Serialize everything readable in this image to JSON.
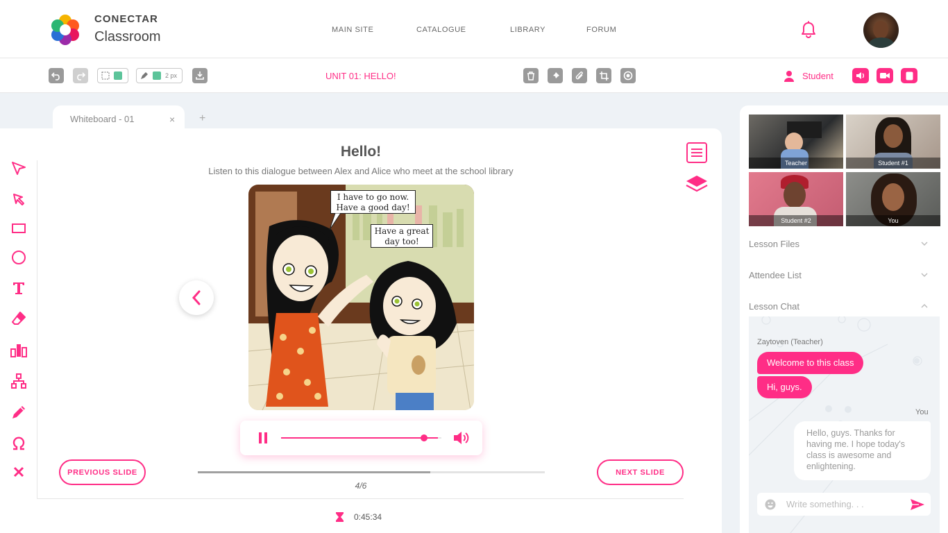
{
  "brand": {
    "name_top": "CONECTAR",
    "name_bottom": "Classroom"
  },
  "nav": [
    "MAIN SITE",
    "CATALOGUE",
    "LIBRARY",
    "FORUM"
  ],
  "toolbar": {
    "unit_title": "UNIT 01: HELLO!",
    "stroke_size": "2 px",
    "role_label": "Student"
  },
  "tabs": {
    "active": "Whiteboard - 01",
    "close": "×",
    "add": "+"
  },
  "slide": {
    "title": "Hello!",
    "subtitle": "Listen to this dialogue between Alex and Alice who meet at the school library",
    "bubble1_line1": "I have to go now.",
    "bubble1_line2": "Have a good day!",
    "bubble2_line1": "Have a great",
    "bubble2_line2": "day too!",
    "prev_label": "PREVIOUS SLIDE",
    "next_label": "NEXT SLIDE",
    "page_indicator": "4/6",
    "timer": "0:45:34",
    "audio_progress": 0.98,
    "slides_progress": 0.67
  },
  "videos": [
    {
      "label": "Teacher"
    },
    {
      "label": "Student #1"
    },
    {
      "label": "Student #2"
    },
    {
      "label": "You"
    }
  ],
  "accordion": {
    "files": "Lesson Files",
    "attendees": "Attendee List",
    "chat": "Lesson Chat"
  },
  "chat": {
    "teacher_name": "Zaytoven (Teacher)",
    "teacher_msg1": "Welcome to this class",
    "teacher_msg2": "Hi, guys.",
    "you_label": "You",
    "you_msg": "Hello, guys. Thanks for having me. I hope today's class is awesome and enlightening.",
    "input_placeholder": "Write something. . ."
  },
  "colors": {
    "accent": "#ff2d86",
    "tool_gray": "#9a9a9a",
    "swatch": "#5cc49a"
  }
}
